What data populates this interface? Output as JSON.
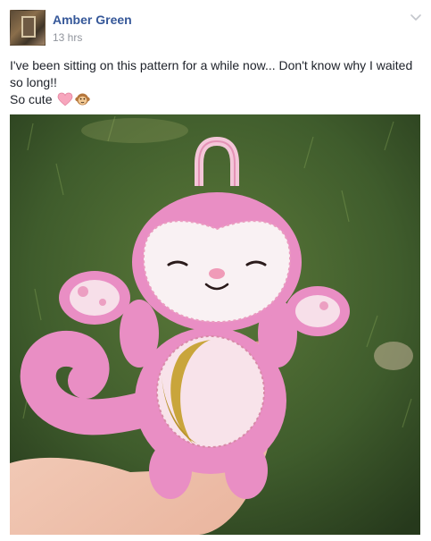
{
  "post": {
    "author": "Amber Green",
    "timestamp": "13 hrs",
    "text_line1": "I've been sitting on this pattern for a while now... Don't know why I waited so long!!",
    "text_line2": "So cute",
    "emojis": [
      "heart-icon",
      "monkey-face-icon"
    ]
  },
  "colors": {
    "name_link": "#365899",
    "meta_text": "#90949c",
    "body_text": "#1d2129",
    "grass": "#3d5a2a",
    "plush_pink": "#ea8cc4"
  }
}
